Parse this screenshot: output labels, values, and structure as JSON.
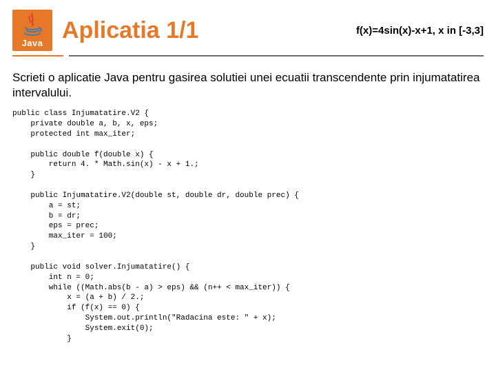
{
  "logo": {
    "text": "Java"
  },
  "header": {
    "title": "Aplicatia 1/1",
    "equation": "f(x)=4sin(x)-x+1,  x in [-3,3]"
  },
  "description": "Scrieti o aplicatie Java pentru gasirea solutiei unei ecuatii transcendente prin injumatatirea intervalului.",
  "code": "public class Injumatatire.V2 {\n    private double a, b, x, eps;\n    protected int max_iter;\n\n    public double f(double x) {\n        return 4. * Math.sin(x) - x + 1.;\n    }\n\n    public Injumatatire.V2(double st, double dr, double prec) {\n        a = st;\n        b = dr;\n        eps = prec;\n        max_iter = 100;\n    }\n\n    public void solver.Injumatatire() {\n        int n = 0;\n        while ((Math.abs(b - a) > eps) && (n++ < max_iter)) {\n            x = (a + b) / 2.;\n            if (f(x) == 0) {\n                System.out.println(\"Radacina este: \" + x);\n                System.exit(0);\n            }"
}
